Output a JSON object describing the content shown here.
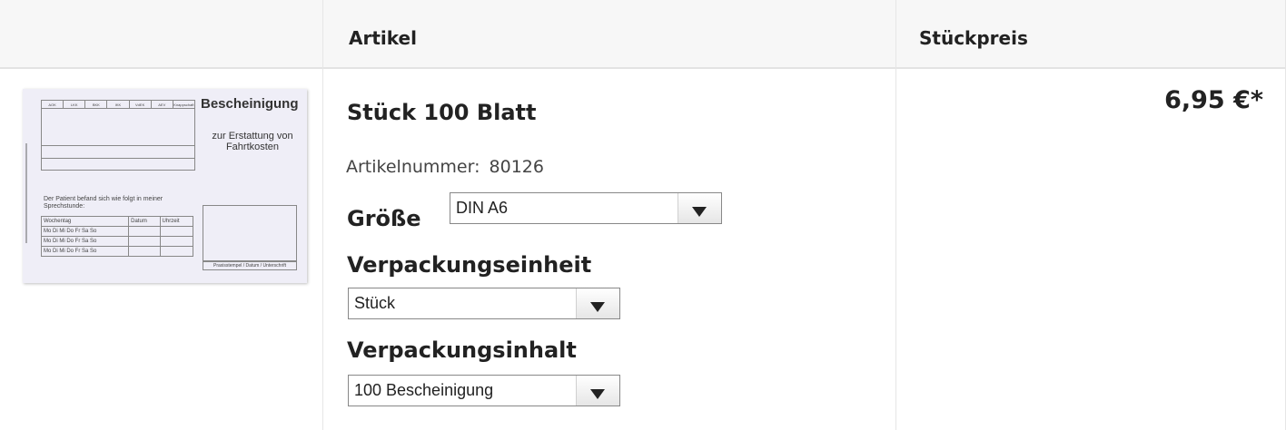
{
  "table": {
    "header": {
      "article": "Artikel",
      "unit_price": "Stückpreis"
    }
  },
  "product": {
    "name": "Stück 100 Blatt",
    "article_number_label": "Artikelnummer:",
    "article_number": "80126",
    "price": "6,95 €*",
    "image": {
      "title": "Bescheinigung",
      "subtitle": "zur Erstattung von Fahrtkosten",
      "insurers": [
        "AOK",
        "LKK",
        "BKK",
        "IKK",
        "VdEK",
        "AEV",
        "Knappschaft"
      ],
      "patient_text": "Der Patient befand sich wie folgt in meiner Sprechstunde:",
      "table_headers": [
        "Wochentag",
        "Datum",
        "Uhrzeit"
      ],
      "weekday_row": "Mo Di Mi Do Fr Sa So",
      "stamp_label": "Praxisstempel / Datum / Unterschrift"
    }
  },
  "options": {
    "size": {
      "label": "Größe",
      "selected": "DIN A6"
    },
    "packaging_unit": {
      "label": "Verpackungseinheit",
      "selected": "Stück"
    },
    "packaging_content": {
      "label": "Verpackungsinhalt",
      "selected": "100 Bescheinigung"
    }
  }
}
